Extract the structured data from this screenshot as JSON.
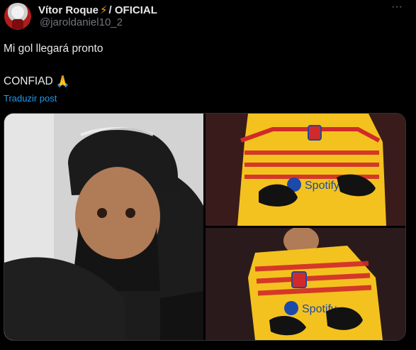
{
  "post": {
    "author_name": "Vítor Roque",
    "author_suffix": "/ OFICIAL",
    "handle": "@jaroldaniel10_2",
    "more_label": "···",
    "line1": "Mi gol llegará pronto",
    "line2": "CONFIAD",
    "emoji": "🙏",
    "translate_label": "Traduzir post"
  },
  "media": {
    "sponsor_text": "Spotify"
  },
  "colors": {
    "background": "#000000",
    "text": "#e7e9ea",
    "secondary": "#71767b",
    "link": "#1d9bf0",
    "border": "#2f3336",
    "accent_bolt": "#f5a623",
    "jersey_yellow": "#f4c21e",
    "jersey_red": "#d12a2a"
  }
}
